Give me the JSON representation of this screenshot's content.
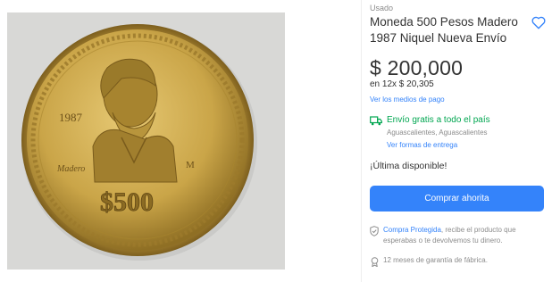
{
  "product": {
    "condition": "Usado",
    "title": "Moneda 500 Pesos Madero 1987 Niquel Nueva Envío",
    "favorite_icon": "heart-icon",
    "image": {
      "subject": "coin-photo",
      "year_text": "1987",
      "name_text": "Madero",
      "value_text": "$500",
      "mint_mark": "M",
      "colors": {
        "background": "#d8d8d6",
        "coin": "#caa548",
        "coin_light": "#e6c873",
        "coin_dark": "#8f6f24"
      }
    }
  },
  "pricing": {
    "price": "$ 200,000",
    "installments": "en 12x $ 20,305",
    "payment_methods_link": "Ver los medios de pago"
  },
  "shipping": {
    "icon": "truck-icon",
    "title": "Envío gratis a todo el país",
    "location": "Aguascalientes, Aguascalientes",
    "shipping_link": "Ver formas de entrega"
  },
  "stock": {
    "label": "¡Última disponible!"
  },
  "actions": {
    "buy_now": "Comprar ahorita"
  },
  "protection": {
    "icon": "shield-icon",
    "link": "Compra Protegida",
    "text": ", recibe el producto que esperabas o te devolvemos tu dinero."
  },
  "warranty": {
    "icon": "ribbon-icon",
    "text": "12 meses de garantía de fábrica."
  },
  "colors": {
    "accent": "#3483fa",
    "success": "#00a650",
    "muted": "#8c8c8c",
    "text": "#333333"
  }
}
